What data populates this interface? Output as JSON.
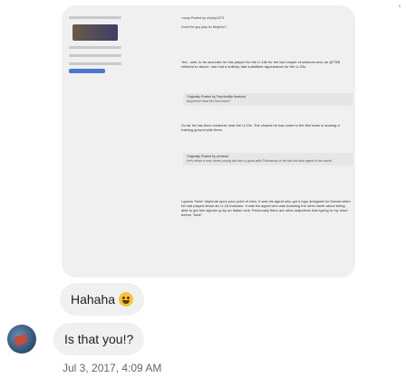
{
  "shared_image": {
    "author": "=onay Posted by chucky1973",
    "question": "Does the guy play for Brighton?",
    "paragraph1": "Yes - well, to be accurate he has played for the U-18s for the last couple of seasons and, as @TSB referred to above, has had a solitary, late substitute appearance for the U-23s.",
    "quote1_title": "Originally Posted by Psychobilly freakout",
    "quote1_text": "Anywhere near the first team?",
    "paragraph2": "So far he has been nowhere near the U-23s. The closest he has come to the first team is sharing a training ground with them.",
    "quote2_title": "Originally Posted by pinhead",
    "quote2_text": "He's either a very bored young lad who is good with Photoshop or he has the best agent in the world.",
    "paragraph3": "I guess \"best\" depends upon your point of view. It was his agent who got a logo designed for Garcia when he had played about six U-18 matches. It was his agent who was boasting the other week about being able to get him signed up by an Italian club. Personally there are other adjectives that spring to my mind before \"best\".",
    "mini_reaction": "0"
  },
  "messages": [
    {
      "text": "Hahaha",
      "has_emoji": true
    },
    {
      "text": "Is that you!?"
    }
  ],
  "timestamp": "Jul 3, 2017, 4:09 AM"
}
